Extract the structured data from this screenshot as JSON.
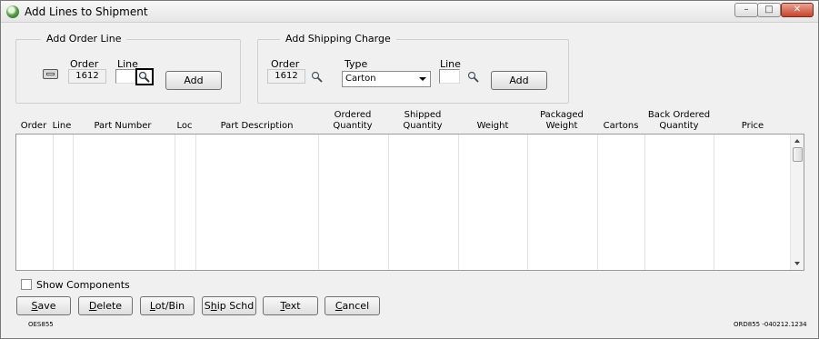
{
  "window": {
    "title": "Add Lines to Shipment",
    "minimize": "–",
    "maximize": "□",
    "close": "✕"
  },
  "add_order_line": {
    "legend": "Add Order Line",
    "order_label": "Order",
    "order_value": "1612",
    "line_label": "Line",
    "line_value": "",
    "add_button": "Add"
  },
  "add_shipping_charge": {
    "legend": "Add Shipping Charge",
    "order_label": "Order",
    "order_value": "1612",
    "type_label": "Type",
    "type_value": "Carton",
    "line_label": "Line",
    "line_value": "",
    "add_button": "Add"
  },
  "grid": {
    "columns": [
      "Order",
      "Line",
      "Part Number",
      "Loc",
      "Part Description",
      "Ordered\nQuantity",
      "Shipped\nQuantity",
      "Weight",
      "Packaged\nWeight",
      "Cartons",
      "Back Ordered\nQuantity",
      "Price"
    ],
    "rows": []
  },
  "show_components": {
    "label": "Show Components",
    "checked": false
  },
  "buttons": {
    "save": {
      "mnemonic": "S",
      "rest": "ave"
    },
    "delete": {
      "mnemonic": "D",
      "rest": "elete"
    },
    "lot_bin": {
      "mnemonic": "L",
      "rest": "ot/Bin"
    },
    "ship_schd": {
      "pre": "S",
      "mnemonic": "h",
      "rest": "ip Schd"
    },
    "text": {
      "mnemonic": "T",
      "rest": "ext"
    },
    "cancel": {
      "mnemonic": "C",
      "rest": "ancel"
    }
  },
  "footer": {
    "left_code": "OES855",
    "right_code": "ORD855 -040212.1234"
  },
  "colors": {
    "window_bg": "#f0f0f0",
    "close_button": "#c7442b"
  }
}
